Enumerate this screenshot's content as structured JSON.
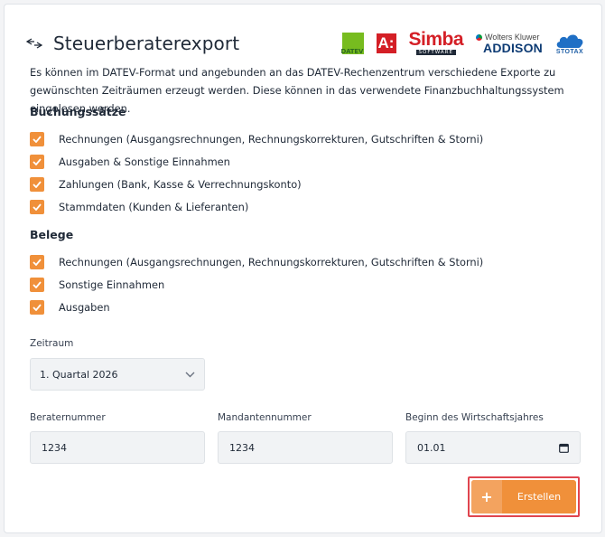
{
  "header": {
    "title": "Steuerberaterexport",
    "icon": "swap-arrows-icon",
    "logos": {
      "datev": {
        "label": "DATEV",
        "color": "#77bc1f"
      },
      "a": {
        "label": "A:",
        "color": "#d41f26"
      },
      "simba": {
        "name": "Simba",
        "sub": "SOFTWARE"
      },
      "wk": {
        "top": "Wolters Kluwer",
        "main": "ADDISON"
      },
      "stotax": {
        "label": "STOTAX"
      }
    }
  },
  "intro": "Es können im DATEV-Format und angebunden an das DATEV-Rechenzentrum verschiedene Exporte zu gewünschten Zeiträumen erzeugt werden. Diese können in das verwendete Finanzbuchhaltungssystem eingelesen werden.",
  "buchungssaetze": {
    "title": "Buchungssätze",
    "items": [
      {
        "label": "Rechnungen (Ausgangsrechnungen, Rechnungskorrekturen, Gutschriften & Storni)",
        "checked": true
      },
      {
        "label": "Ausgaben & Sonstige Einnahmen",
        "checked": true
      },
      {
        "label": "Zahlungen (Bank, Kasse & Verrechnungskonto)",
        "checked": true
      },
      {
        "label": "Stammdaten (Kunden & Lieferanten)",
        "checked": true
      }
    ]
  },
  "belege": {
    "title": "Belege",
    "items": [
      {
        "label": "Rechnungen (Ausgangsrechnungen, Rechnungskorrekturen, Gutschriften & Storni)",
        "checked": true
      },
      {
        "label": "Sonstige Einnahmen",
        "checked": true
      },
      {
        "label": "Ausgaben",
        "checked": true
      }
    ]
  },
  "zeitraum": {
    "label": "Zeitraum",
    "value": "1. Quartal 2026"
  },
  "fields": {
    "beraternummer": {
      "label": "Beraternummer",
      "value": "1234"
    },
    "mandantennummer": {
      "label": "Mandantennummer",
      "value": "1234"
    },
    "wirtschaftsjahr": {
      "label": "Beginn des Wirtschaftsjahres",
      "value": "01.01"
    }
  },
  "actions": {
    "create_label": "Erstellen",
    "create_icon": "+"
  },
  "colors": {
    "accent": "#f0903a",
    "highlight": "#e0454f"
  }
}
